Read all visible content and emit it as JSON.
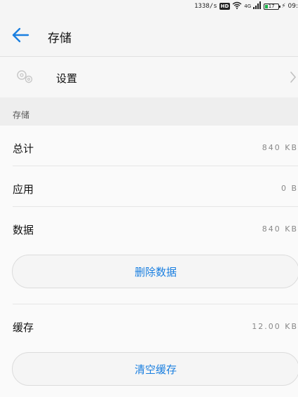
{
  "status_bar": {
    "speed": "1338/s",
    "hd": "HD",
    "network": "4G",
    "battery_level": "17",
    "time": "09:"
  },
  "header": {
    "title": "存储",
    "back_icon": "arrow-left-icon"
  },
  "settings": {
    "label": "设置",
    "icon": "gear-icon",
    "chevron_icon": "chevron-right-icon"
  },
  "storage": {
    "section_title": "存储",
    "rows": [
      {
        "label": "总计",
        "value": "840 KB"
      },
      {
        "label": "应用",
        "value": "0 B"
      },
      {
        "label": "数据",
        "value": "840 KB"
      }
    ],
    "clear_data_label": "删除数据"
  },
  "cache": {
    "label": "缓存",
    "value": "12.00 KB",
    "clear_cache_label": "清空缓存"
  },
  "colors": {
    "accent": "#1a7fe0",
    "background": "#f5f5f5",
    "battery": "#19b34a"
  }
}
